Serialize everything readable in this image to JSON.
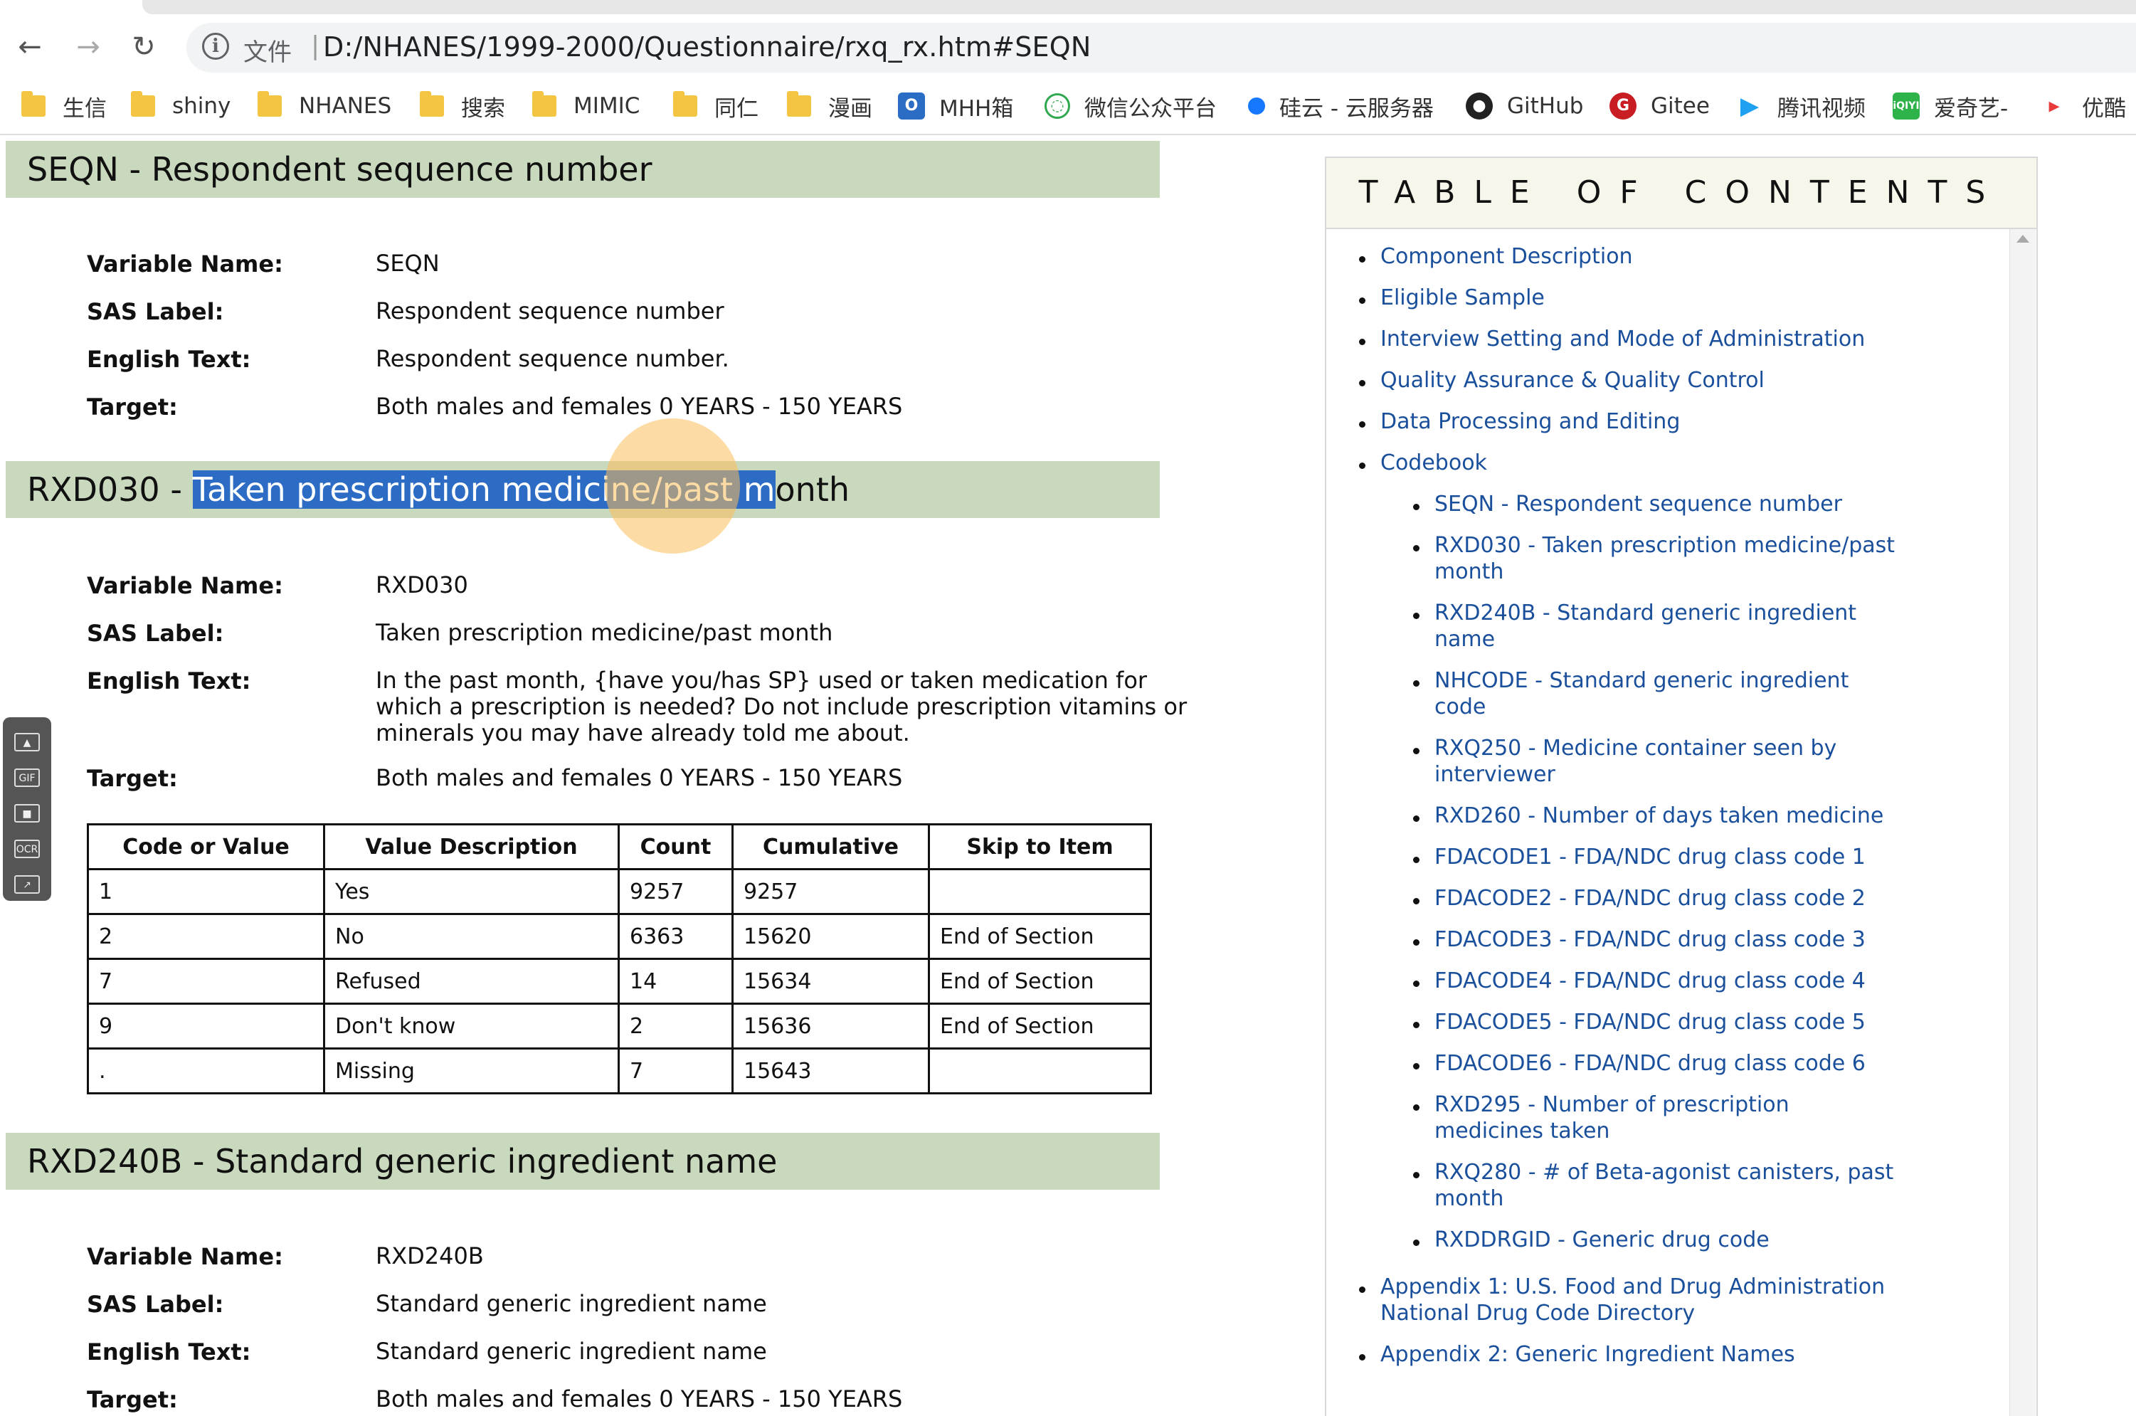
{
  "browser": {
    "protocol_label": "文件",
    "url": "D:/NHANES/1999-2000/Questionnaire/rxq_rx.htm#SEQN",
    "back_icon": "arrow-left-icon",
    "forward_icon": "arrow-right-icon",
    "reload_icon": "reload-icon",
    "bookmarks": [
      {
        "label": "生信",
        "icon": "folder-icon"
      },
      {
        "label": "shiny",
        "icon": "folder-icon"
      },
      {
        "label": "NHANES",
        "icon": "folder-icon"
      },
      {
        "label": "搜索",
        "icon": "folder-icon"
      },
      {
        "label": "MIMIC",
        "icon": "folder-icon"
      },
      {
        "label": "同仁",
        "icon": "folder-icon"
      },
      {
        "label": "漫画",
        "icon": "folder-icon"
      },
      {
        "label": "MHH箱",
        "icon": "outlook-icon"
      },
      {
        "label": "微信公众平台",
        "icon": "wechat-icon"
      },
      {
        "label": "硅云 - 云服务器",
        "icon": "cloud-icon"
      },
      {
        "label": "GitHub",
        "icon": "github-icon"
      },
      {
        "label": "Gitee",
        "icon": "gitee-icon"
      },
      {
        "label": "腾讯视频",
        "icon": "tencent-video-icon"
      },
      {
        "label": "爱奇艺-",
        "icon": "iqiyi-icon"
      },
      {
        "label": "优酷",
        "icon": "youku-icon"
      }
    ]
  },
  "sections": {
    "seqn": {
      "title": "SEQN - Respondent sequence number",
      "fields": [
        {
          "key": "Variable Name:",
          "value": "SEQN"
        },
        {
          "key": "SAS Label:",
          "value": "Respondent sequence number"
        },
        {
          "key": "English Text:",
          "value": "Respondent sequence number."
        },
        {
          "key": "Target:",
          "value": "Both males and females 0 YEARS - 150 YEARS"
        }
      ]
    },
    "rxd030": {
      "title_prefix": "RXD030 - ",
      "title_highlighted": "Taken prescription medicine/past m",
      "title_rest": "onth",
      "fields": [
        {
          "key": "Variable Name:",
          "value": "RXD030"
        },
        {
          "key": "SAS Label:",
          "value": "Taken prescription medicine/past month"
        },
        {
          "key": "English Text:",
          "value": "In the past month, {have you/has SP} used or taken medication for which a prescription is needed? Do not include prescription vitamins or minerals you may have already told me about."
        },
        {
          "key": "Target:",
          "value": "Both males and females 0 YEARS - 150 YEARS"
        }
      ],
      "table": {
        "headers": [
          "Code or Value",
          "Value Description",
          "Count",
          "Cumulative",
          "Skip to Item"
        ],
        "rows": [
          [
            "1",
            "Yes",
            "9257",
            "9257",
            ""
          ],
          [
            "2",
            "No",
            "6363",
            "15620",
            "End of Section"
          ],
          [
            "7",
            "Refused",
            "14",
            "15634",
            "End of Section"
          ],
          [
            "9",
            "Don't know",
            "2",
            "15636",
            "End of Section"
          ],
          [
            ".",
            "Missing",
            "7",
            "15643",
            ""
          ]
        ]
      }
    },
    "rxd240b": {
      "title": "RXD240B - Standard generic ingredient name",
      "fields": [
        {
          "key": "Variable Name:",
          "value": "RXD240B"
        },
        {
          "key": "SAS Label:",
          "value": "Standard generic ingredient name"
        },
        {
          "key": "English Text:",
          "value": "Standard generic ingredient name"
        },
        {
          "key": "Target:",
          "value": "Both males and females 0 YEARS - 150 YEARS"
        }
      ]
    }
  },
  "floatbar": {
    "buttons": [
      "screenshot-icon",
      "gif-icon",
      "record-icon",
      "ocr-icon",
      "share-icon"
    ],
    "labels": [
      "",
      "GIF",
      "",
      "OCR",
      ""
    ]
  },
  "toc": {
    "title": "TABLE OF CONTENTS",
    "items": [
      "Component Description",
      "Eligible Sample",
      "Interview Setting and Mode of Administration",
      "Quality Assurance & Quality Control",
      "Data Processing and Editing",
      "Codebook"
    ],
    "codebook_items": [
      "SEQN - Respondent sequence number",
      "RXD030 - Taken prescription medicine/past month",
      "RXD240B - Standard generic ingredient name",
      "NHCODE - Standard generic ingredient code",
      "RXQ250 - Medicine container seen by interviewer",
      "RXD260 - Number of days taken medicine",
      "FDACODE1 - FDA/NDC drug class code 1",
      "FDACODE2 - FDA/NDC drug class code 2",
      "FDACODE3 - FDA/NDC drug class code 3",
      "FDACODE4 - FDA/NDC drug class code 4",
      "FDACODE5 - FDA/NDC drug class code 5",
      "FDACODE6 - FDA/NDC drug class code 6",
      "RXD295 - Number of prescription medicines taken",
      "RXQ280 - # of Beta-agonist canisters, past month",
      "RXDDRGID - Generic drug code"
    ],
    "appendix_items": [
      "Appendix 1: U.S. Food and Drug Administration National Drug Code Directory",
      "Appendix 2: Generic Ingredient Names"
    ]
  }
}
